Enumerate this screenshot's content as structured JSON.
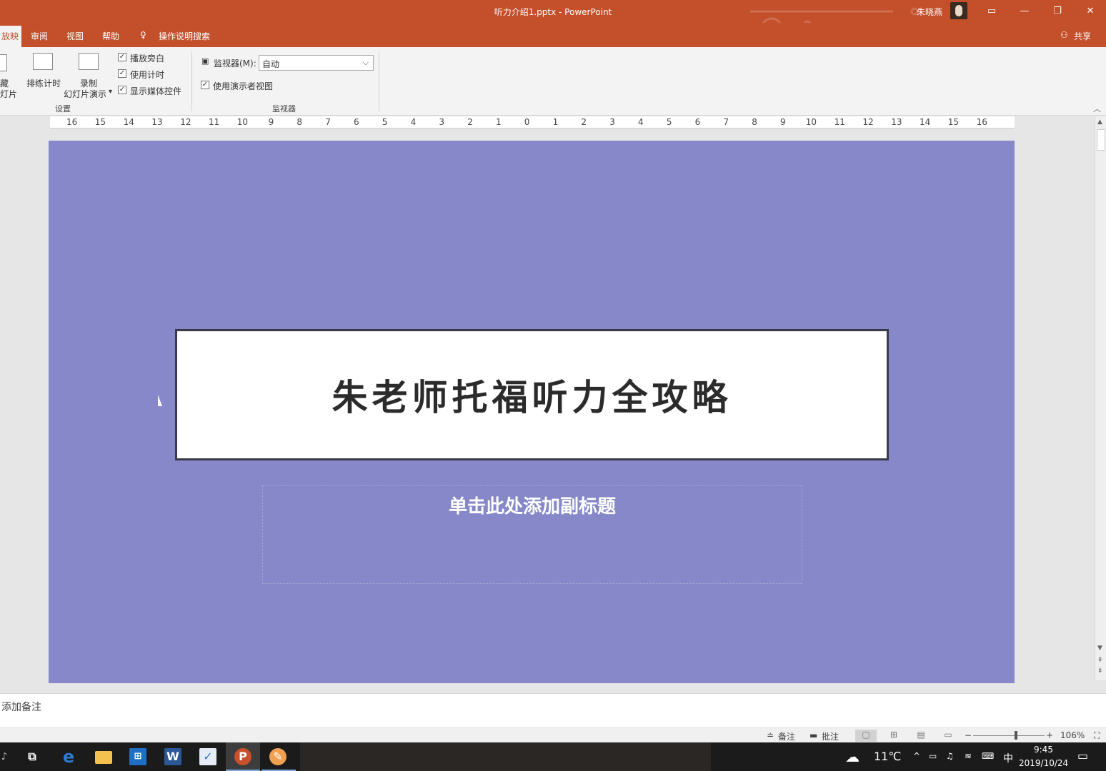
{
  "window": {
    "title": "听力介绍1.pptx  -  PowerPoint",
    "user_name": "朱晓燕",
    "share_label": "共享"
  },
  "tabs": [
    {
      "label": "放映",
      "active": true
    },
    {
      "label": "审阅"
    },
    {
      "label": "视图"
    },
    {
      "label": "帮助"
    }
  ],
  "tell_me": {
    "label": "操作说明搜索"
  },
  "ribbon": {
    "hide_slide_label_1": "隐藏",
    "hide_slide_label_2": "幻灯片",
    "rehearse_label": "排练计时",
    "record_label_1": "录制",
    "record_label_2": "幻灯片演示",
    "record_dropdown": "▾",
    "checks": [
      {
        "label": "播放旁白",
        "checked": true
      },
      {
        "label": "使用计时",
        "checked": true
      },
      {
        "label": "显示媒体控件",
        "checked": true
      }
    ],
    "setup_group_label": "设置",
    "monitor_label": "监视器(M):",
    "monitor_value": "自动",
    "presenter_view_label": "使用演示者视图",
    "presenter_view_checked": true,
    "monitors_group_label": "监视器"
  },
  "ruler": {
    "ticks": [
      "16",
      "15",
      "14",
      "13",
      "12",
      "11",
      "10",
      "9",
      "8",
      "7",
      "6",
      "5",
      "4",
      "3",
      "2",
      "1",
      "0",
      "1",
      "2",
      "3",
      "4",
      "5",
      "6",
      "7",
      "8",
      "9",
      "10",
      "11",
      "12",
      "13",
      "14",
      "15",
      "16"
    ]
  },
  "slide": {
    "background_color": "#8688c9",
    "title": "朱老师托福听力全攻略",
    "subtitle_placeholder": "单击此处添加副标题"
  },
  "notes": {
    "placeholder": "添加备注"
  },
  "status": {
    "notes_label": "备注",
    "comments_label": "批注",
    "zoom_value": "106%",
    "zoom_level_percent": 60,
    "zoom_minus": "−",
    "zoom_plus": "+"
  },
  "taskbar": {
    "apps": [
      "task-view",
      "edge",
      "file-explorer",
      "store",
      "word",
      "feishu",
      "powerpoint",
      "paint"
    ],
    "weather": "11℃",
    "ime": "中",
    "time": "9:45",
    "date": "2019/10/24"
  }
}
